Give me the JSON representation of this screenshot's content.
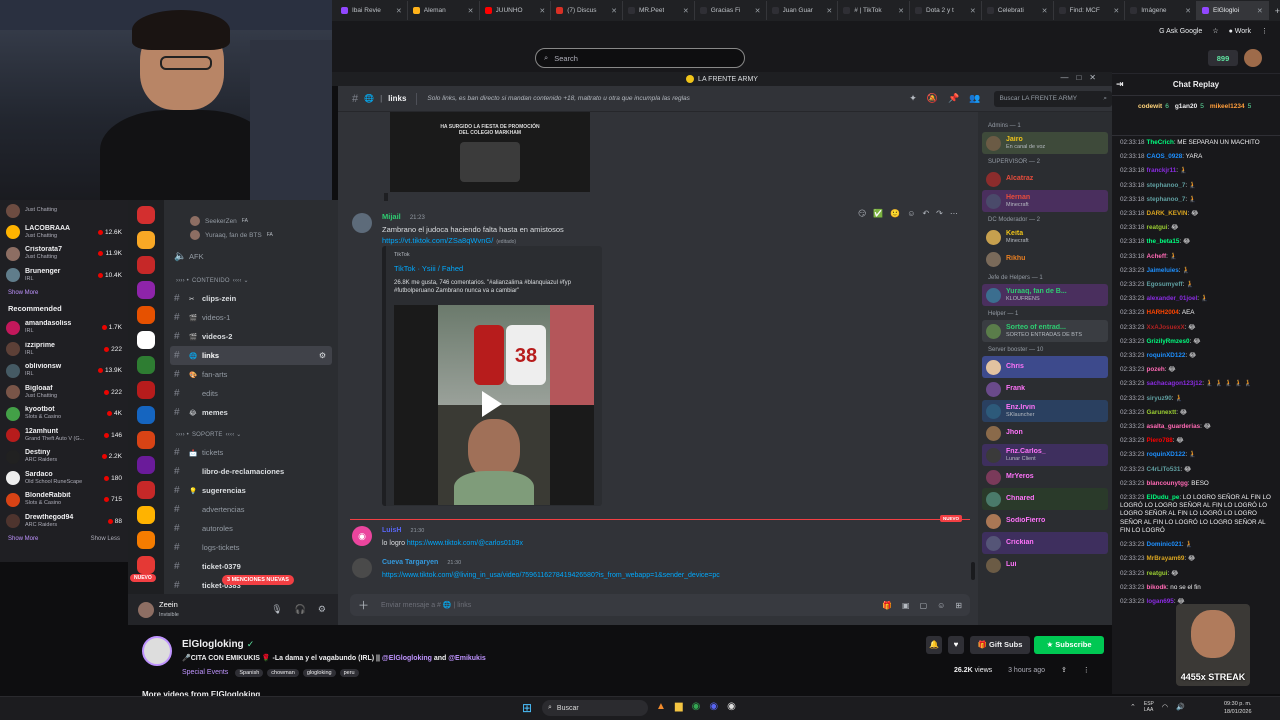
{
  "browser": {
    "tabs": [
      {
        "label": "Ibai Revie",
        "color": "#9147ff"
      },
      {
        "label": "Aleman",
        "color": "#ffb31a"
      },
      {
        "label": "JUUNHO",
        "color": "#ff0000"
      },
      {
        "label": "(7) Discus",
        "color": "#d93025"
      },
      {
        "label": "MR.Peet",
        "color": "#2f2f35"
      },
      {
        "label": "Gracias Fi",
        "color": "#2f2f35"
      },
      {
        "label": "Juan Guar",
        "color": "#2f2f35"
      },
      {
        "label": "# | TikTok",
        "color": "#2f2f35"
      },
      {
        "label": "Dota 2 y t",
        "color": "#2f2f35"
      },
      {
        "label": "Celebrati",
        "color": "#2f2f35"
      },
      {
        "label": "Find: MCF",
        "color": "#2f2f35"
      },
      {
        "label": "Imágene",
        "color": "#2f2f35"
      },
      {
        "label": "ElGlogloi",
        "color": "#9147ff"
      }
    ],
    "new_tab": "+",
    "ask_google": "Ask Google",
    "profile_label": "Work"
  },
  "twitch": {
    "search_placeholder": "Search",
    "points": "899",
    "nav": {
      "followed": [
        {
          "name": "",
          "game": "Just Chatting",
          "viewers": "",
          "color": "#6d4c41"
        },
        {
          "name": "LACOBRAAA",
          "game": "Just Chatting",
          "viewers": "12.6K",
          "color": "#ffb300"
        },
        {
          "name": "Cristorata7",
          "game": "Just Chatting",
          "viewers": "11.9K",
          "color": "#8d6e63"
        },
        {
          "name": "Brunenger",
          "game": "IRL",
          "viewers": "10.4K",
          "color": "#607d8b"
        }
      ],
      "show_more": "Show More",
      "recommended_title": "Recommended",
      "recommended": [
        {
          "name": "amandasoliss",
          "game": "IRL",
          "viewers": "1.7K",
          "color": "#c2185b"
        },
        {
          "name": "izziprime",
          "game": "IRL",
          "viewers": "222",
          "color": "#5d4037"
        },
        {
          "name": "oblivionsw",
          "game": "IRL",
          "viewers": "13.9K",
          "color": "#455a64"
        },
        {
          "name": "Bigloaaf",
          "game": "Just Chatting",
          "viewers": "222",
          "color": "#795548"
        },
        {
          "name": "kyootbot",
          "game": "Slots & Casino",
          "viewers": "4K",
          "color": "#43a047"
        },
        {
          "name": "12amhunt",
          "game": "Grand Theft Auto V (G...",
          "viewers": "146",
          "color": "#b71c1c"
        },
        {
          "name": "Destiny",
          "game": "ARC Raiders",
          "viewers": "2.2K",
          "color": "#212121"
        },
        {
          "name": "Sardaco",
          "game": "Old School RuneScape",
          "viewers": "180",
          "color": "#eeeeee"
        },
        {
          "name": "BlondeRabbit",
          "game": "Slots & Casino",
          "viewers": "715",
          "color": "#d84315"
        },
        {
          "name": "Drewthegod94",
          "game": "ARC Raiders",
          "viewers": "88",
          "color": "#4e342e"
        }
      ],
      "show_more2": "Show More",
      "show_less": "Show Less"
    },
    "chat": {
      "title": "Chat Replay",
      "leaders": [
        {
          "name": "codewit",
          "count": "6"
        },
        {
          "name": "g1an20",
          "count": "5"
        },
        {
          "name": "mikeel1234",
          "count": "5"
        }
      ],
      "messages": [
        {
          "time": "02:33:18",
          "user": "TheCrich",
          "color": "#00ff7f",
          "text": ": ME SEPARAN UN MACHITO"
        },
        {
          "time": "02:33:18",
          "user": "CAOS_0928",
          "color": "#1e90ff",
          "text": ": YARA"
        },
        {
          "time": "02:33:18",
          "user": "franckjr11",
          "color": "#8a2be2",
          "text": ": 🧎"
        },
        {
          "time": "02:33:18",
          "user": "stephanoo_7",
          "color": "#5f9ea0",
          "text": ": 🧎"
        },
        {
          "time": "02:33:18",
          "user": "stephanoo_7",
          "color": "#5f9ea0",
          "text": ": 🧎"
        },
        {
          "time": "02:33:18",
          "user": "DARK_KEVIN",
          "color": "#daa520",
          "text": ": 😂"
        },
        {
          "time": "02:33:18",
          "user": "reatgui",
          "color": "#9acd32",
          "text": ": 😂"
        },
        {
          "time": "02:33:18",
          "user": "the_beta15",
          "color": "#00ff7f",
          "text": ": 😂"
        },
        {
          "time": "02:33:18",
          "user": "Acheff",
          "color": "#ff69b4",
          "text": ": 🧎"
        },
        {
          "time": "02:33:23",
          "user": "Jaimeluies",
          "color": "#1e90ff",
          "text": ": 🧎"
        },
        {
          "time": "02:33:23",
          "user": "Egosumyeff",
          "color": "#5f9ea0",
          "text": ": 🧎"
        },
        {
          "time": "02:33:23",
          "user": "alexander_01joel",
          "color": "#8a2be2",
          "text": ": 🧎"
        },
        {
          "time": "02:33:23",
          "user": "HARH2004",
          "color": "#ff4500",
          "text": ": AEA"
        },
        {
          "time": "02:33:23",
          "user": "XxAJosuexX",
          "color": "#b22222",
          "text": ": 😂"
        },
        {
          "time": "02:33:23",
          "user": "GrizilyRmzes0",
          "color": "#00ff7f",
          "text": ": 😂"
        },
        {
          "time": "02:33:23",
          "user": "roquinXD122",
          "color": "#1e90ff",
          "text": ": 😂"
        },
        {
          "time": "02:33:23",
          "user": "pozeh",
          "color": "#ff69b4",
          "text": ": 😂"
        },
        {
          "time": "02:33:23",
          "user": "sachacagon123j12",
          "color": "#8a2be2",
          "text": ": 🧎 🧎 🧎 🧎 🧎"
        },
        {
          "time": "02:33:23",
          "user": "siryuz90",
          "color": "#5f9ea0",
          "text": ": 🧎"
        },
        {
          "time": "02:33:23",
          "user": "Garunextt",
          "color": "#9acd32",
          "text": ": 😂"
        },
        {
          "time": "02:33:23",
          "user": "asalta_guarderias",
          "color": "#ff69b4",
          "text": ": 😂"
        },
        {
          "time": "02:33:23",
          "user": "Piero788",
          "color": "#ff0000",
          "text": ": 😂"
        },
        {
          "time": "02:33:23",
          "user": "roquinXD122",
          "color": "#1e90ff",
          "text": ": 🧎"
        },
        {
          "time": "02:33:23",
          "user": "C4rLiTo531",
          "color": "#5f9ea0",
          "text": ": 😂"
        },
        {
          "time": "02:33:23",
          "user": "blancounytgg",
          "color": "#ff69b4",
          "text": ": BESO"
        },
        {
          "time": "02:33:23",
          "user": "ElDudu_pe",
          "color": "#00ff7f",
          "text": ": LO LOGRO SEÑOR AL FIN LO LOGRÓ LO LOGRO SEÑOR AL FIN LO LOGRÓ LO LOGRO SEÑOR AL FIN LO LOGRÓ LO LOGRO SEÑOR AL FIN LO LOGRÓ LO LOGRO SEÑOR AL FIN LO LOGRÓ"
        },
        {
          "time": "02:33:23",
          "user": "Dominic021",
          "color": "#1e90ff",
          "text": ": 🧎"
        },
        {
          "time": "02:33:23",
          "user": "MrBrayam69",
          "color": "#daa520",
          "text": ": 😂"
        },
        {
          "time": "02:33:23",
          "user": "reatgui",
          "color": "#9acd32",
          "text": ": 😂"
        },
        {
          "time": "02:33:23",
          "user": "bikodk",
          "color": "#ff69b4",
          "text": ": no se el fin"
        },
        {
          "time": "02:33:23",
          "user": "logan695",
          "color": "#8a2be2",
          "text": ": 😂"
        }
      ],
      "streak_overlay": "4455x STREAK"
    },
    "channel": {
      "name": "ElGlogloking",
      "title_prefix": "🎤CITA CON EMIKUKIS 🌹 -La dama y el vagabundo (IRL) || ",
      "mention1": "@ElGlogloking",
      "and": " and ",
      "mention2": "@Emikukis",
      "category": "Special Events",
      "tags": [
        "Spanish",
        "chowman",
        "glogloking",
        "peru"
      ],
      "views": "26.2K",
      "views_label": " views",
      "ago": "3 hours ago",
      "gift_subs": "Gift Subs",
      "subscribe": "Subscribe",
      "more_videos": "More videos from ElGlogloking"
    }
  },
  "discord": {
    "server": "LA FRENTE ARMY",
    "channel": "links",
    "topic": "Solo links, es ban directo si mandan contenido +18, maltrato u otra que incumpla las reglas",
    "search_placeholder": "Buscar LA FRENTE ARMY",
    "voice_users": [
      {
        "name": "SeekerZen",
        "badge": "FA"
      },
      {
        "name": "Yuraaq, fan de BTS",
        "badge": "FA"
      }
    ],
    "afk": "AFK",
    "categories": {
      "contenido": "CONTENIDO",
      "soporte": "SOPORTE"
    },
    "channels_contenido": [
      {
        "name": "clips-zein",
        "bright": true,
        "emoji": "✂"
      },
      {
        "name": "videos-1",
        "bright": false,
        "emoji": "🎬"
      },
      {
        "name": "videos-2",
        "bright": true,
        "emoji": "🎬"
      },
      {
        "name": "links",
        "bright": true,
        "emoji": "🌐",
        "selected": true
      },
      {
        "name": "fan-arts",
        "bright": false,
        "emoji": "🎨"
      },
      {
        "name": "edits",
        "bright": false,
        "emoji": ""
      },
      {
        "name": "memes",
        "bright": true,
        "emoji": "😂"
      }
    ],
    "channels_soporte": [
      {
        "name": "tickets",
        "bright": false,
        "emoji": "📩"
      },
      {
        "name": "libro-de-reclamaciones",
        "bright": true,
        "emoji": ""
      },
      {
        "name": "sugerencias",
        "bright": true,
        "emoji": "💡"
      },
      {
        "name": "advertencias",
        "bright": false,
        "emoji": ""
      },
      {
        "name": "autoroles",
        "bright": false,
        "emoji": ""
      },
      {
        "name": "logs-tickets",
        "bright": false,
        "emoji": ""
      },
      {
        "name": "ticket-0379",
        "bright": true,
        "emoji": ""
      },
      {
        "name": "ticket-0383",
        "bright": true,
        "emoji": ""
      }
    ],
    "mentions_badge": "3 MENCIONES NUEVAS",
    "new_badge": "NUEVO",
    "user": {
      "name": "Zeein",
      "status": "Invisible"
    },
    "messages": {
      "m1": {
        "author": "Mijail",
        "time": "21:23",
        "text": "Zambrano el judoca haciendo falta hasta en amistosos",
        "link": "https://vt.tiktok.com/ZSa8qWvnG/",
        "edited": "(editado)"
      },
      "embed": {
        "provider": "TikTok",
        "title": "TikTok · Ysiii / Fahed",
        "desc": "26.8K me gusta, 746 comentarios. \"#alianzalima #blanquiazul #fyp #futbolperuano Zambrano nunca va a cambiar\""
      },
      "video_top_text": "HA SURGIDO LA FIESTA DE PROMOCIÓN DEL COLEGIO MARKHAM",
      "jersey_number": "38",
      "m2": {
        "author": "LuisH",
        "time": "21:30",
        "prefix": "lo logro ",
        "link": "https://www.tiktok.com/@carlos0109x"
      },
      "m3": {
        "author": "Cueva Targaryen",
        "time": "21:30",
        "link": "https://www.tiktok.com/@living_in_usa/video/7596116278419426580?is_from_webapp=1&sender_device=pc"
      },
      "new_divider": "NUEVO"
    },
    "input_placeholder": "Enviar mensaje a # 🌐 | links",
    "members": [
      {
        "group": "Admins — 1",
        "items": [
          {
            "name": "Jairo",
            "status": "En canal de voz",
            "color": "#f0c419",
            "bg": "#3e4a3a"
          }
        ]
      },
      {
        "group": "SUPERVISOR — 2",
        "items": [
          {
            "name": "Alcatraz",
            "status": "",
            "color": "#e74c3c",
            "bg": ""
          },
          {
            "name": "Hernan",
            "status": "Minecraft",
            "color": "#e74c3c",
            "bg": "#4a2f5e"
          }
        ]
      },
      {
        "group": "DC Moderador — 2",
        "items": [
          {
            "name": "Keita",
            "status": "Minecraft",
            "color": "#f0c419",
            "bg": ""
          },
          {
            "name": "Rikhu",
            "status": "",
            "color": "#e67e22",
            "bg": ""
          }
        ]
      },
      {
        "group": "Jefe de Helpers — 1",
        "items": [
          {
            "name": "Yuraaq, fan de B...",
            "status": "KLOUFRENS",
            "color": "#2ecc71",
            "bg": "#4a2f5e"
          }
        ]
      },
      {
        "group": "Helper — 1",
        "items": [
          {
            "name": "Sorteo of entrad...",
            "status": "SORTEO ENTRADAS DE BTS",
            "color": "#2ecc71",
            "bg": "#3a3d42"
          }
        ]
      },
      {
        "group": "Server booster — 10",
        "items": [
          {
            "name": "Chris",
            "status": "",
            "color": "#ff73fa",
            "bg": "#3d4a8c"
          },
          {
            "name": "Frank",
            "status": "",
            "color": "#ff73fa",
            "bg": ""
          },
          {
            "name": "Enz.Irvin",
            "status": "SKlauncher",
            "color": "#ff73fa",
            "bg": "#2a4060"
          },
          {
            "name": "Jhon",
            "status": "",
            "color": "#ff73fa",
            "bg": ""
          },
          {
            "name": "Fnz.Carlos_",
            "status": "Lunar Client",
            "color": "#ff73fa",
            "bg": "#3e2f5e"
          },
          {
            "name": "MrYeros",
            "status": "",
            "color": "#ff73fa",
            "bg": ""
          },
          {
            "name": "Chnared",
            "status": "",
            "color": "#ff73fa",
            "bg": "#2a3a2a"
          },
          {
            "name": "SodioFierro",
            "status": "",
            "color": "#ff73fa",
            "bg": ""
          },
          {
            "name": "Crickian",
            "status": "",
            "color": "#ff73fa",
            "bg": "#3e2f5e"
          },
          {
            "name": "Lui",
            "status": "",
            "color": "#ff73fa",
            "bg": ""
          }
        ]
      }
    ]
  },
  "taskbar": {
    "search": "Buscar",
    "lang": "ESP\nLAA",
    "time": "09:30 p. m.",
    "date": "18/01/2026"
  }
}
